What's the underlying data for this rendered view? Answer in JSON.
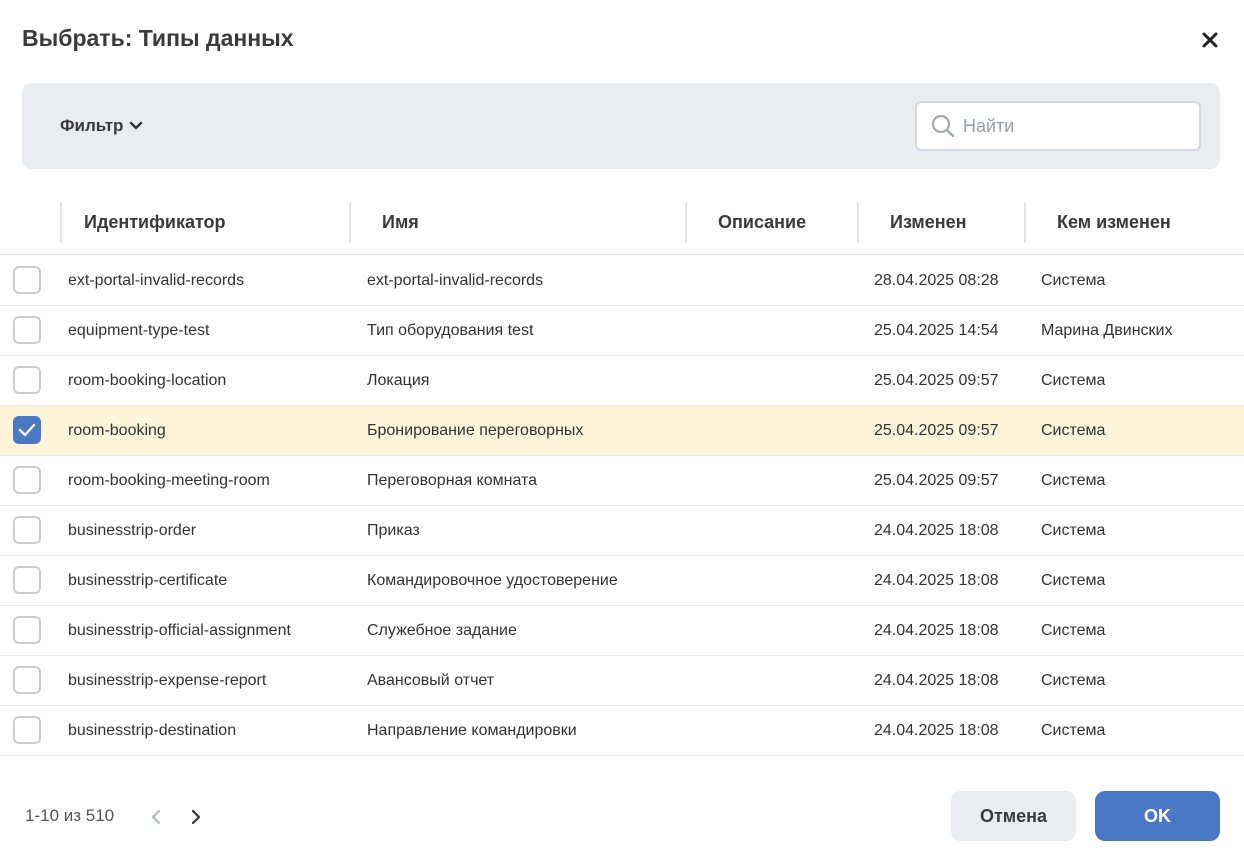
{
  "dialog": {
    "title": "Выбрать: Типы данных",
    "close_icon": "close-icon"
  },
  "toolbar": {
    "filter_label": "Фильтр",
    "search_placeholder": "Найти",
    "search_value": ""
  },
  "table": {
    "columns": [
      "Идентификатор",
      "Имя",
      "Описание",
      "Изменен",
      "Кем изменен"
    ],
    "rows": [
      {
        "checked": false,
        "id": "ext-portal-invalid-records",
        "name": "ext-portal-invalid-records",
        "description": "",
        "modified": "28.04.2025 08:28",
        "modified_by": "Система"
      },
      {
        "checked": false,
        "id": "equipment-type-test",
        "name": "Тип оборудования test",
        "description": "",
        "modified": "25.04.2025 14:54",
        "modified_by": "Марина Двинских"
      },
      {
        "checked": false,
        "id": "room-booking-location",
        "name": "Локация",
        "description": "",
        "modified": "25.04.2025 09:57",
        "modified_by": "Система"
      },
      {
        "checked": true,
        "id": "room-booking",
        "name": "Бронирование переговорных",
        "description": "",
        "modified": "25.04.2025 09:57",
        "modified_by": "Система"
      },
      {
        "checked": false,
        "id": "room-booking-meeting-room",
        "name": "Переговорная комната",
        "description": "",
        "modified": "25.04.2025 09:57",
        "modified_by": "Система"
      },
      {
        "checked": false,
        "id": "businesstrip-order",
        "name": "Приказ",
        "description": "",
        "modified": "24.04.2025 18:08",
        "modified_by": "Система"
      },
      {
        "checked": false,
        "id": "businesstrip-certificate",
        "name": "Командировочное удостоверение",
        "description": "",
        "modified": "24.04.2025 18:08",
        "modified_by": "Система"
      },
      {
        "checked": false,
        "id": "businesstrip-official-assignment",
        "name": "Служебное задание",
        "description": "",
        "modified": "24.04.2025 18:08",
        "modified_by": "Система"
      },
      {
        "checked": false,
        "id": "businesstrip-expense-report",
        "name": "Авансовый отчет",
        "description": "",
        "modified": "24.04.2025 18:08",
        "modified_by": "Система"
      },
      {
        "checked": false,
        "id": "businesstrip-destination",
        "name": "Направление командировки",
        "description": "",
        "modified": "24.04.2025 18:08",
        "modified_by": "Система"
      }
    ]
  },
  "footer": {
    "page_info": "1-10 из 510",
    "cancel_label": "Отмена",
    "ok_label": "OK"
  },
  "colors": {
    "accent": "#4a78c2",
    "selected_row": "#fdf4d9",
    "toolbar_bg": "#e9edf0"
  }
}
